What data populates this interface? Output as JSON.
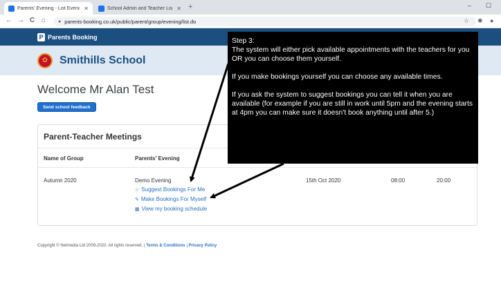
{
  "browser": {
    "tabs": [
      {
        "title": "Parents' Evening - List Evenings",
        "active": true
      },
      {
        "title": "School Admin and Teacher Login",
        "active": false
      }
    ],
    "new_tab": "+",
    "url": "parents-booking.co.uk/public/parent/group/evening/list.do",
    "nav": {
      "back": "←",
      "forward": "→",
      "reload": "C",
      "home": "⌂"
    },
    "window": {
      "minimize": "–",
      "maximize": "☐"
    },
    "toolbar_icons": {
      "star": "☆",
      "extensions": "✱",
      "profile": "●"
    }
  },
  "site": {
    "brand_mark": "P",
    "brand_name": "Parents Booking",
    "school_name": "Smithills School",
    "welcome": "Welcome Mr Alan Test",
    "feedback_button": "Send school feedback"
  },
  "panel": {
    "title": "Parent-Teacher Meetings",
    "headers": {
      "group": "Name of Group",
      "evening": "Parents' Evening"
    },
    "row": {
      "group": "Autumn 2020",
      "evening": "Demo Evening",
      "date": "15th Oct 2020",
      "start": "08:00",
      "end": "20:00"
    },
    "actions": {
      "suggest": "Suggest Bookings For Me",
      "make": "Make Bookings For Myself",
      "view": "View my booking schedule"
    }
  },
  "footer": {
    "copyright": "Copyright © Netmedia Ltd 2009-2020. All rights reserved. |",
    "terms": "Terms & Conditions",
    "sep": "|",
    "privacy": "Privacy Policy"
  },
  "callout": {
    "step": "Step 3:",
    "line1": "The system will either pick available appointments with the teachers for you OR you can choose them yourself.",
    "line2": "If you make bookings yourself you can choose any available times.",
    "line3": "If you ask the system to suggest bookings you can tell it when you are available (for example if you are still in work until 5pm and the evening starts at 4pm you can make sure it doesn't book anything until after 5.)"
  },
  "colors": {
    "brand_blue": "#1a4f80",
    "school_band": "#dfe9f3",
    "link_blue": "#2a6fc2",
    "button_blue": "#1e6fd0",
    "callout_bg": "#000000"
  }
}
